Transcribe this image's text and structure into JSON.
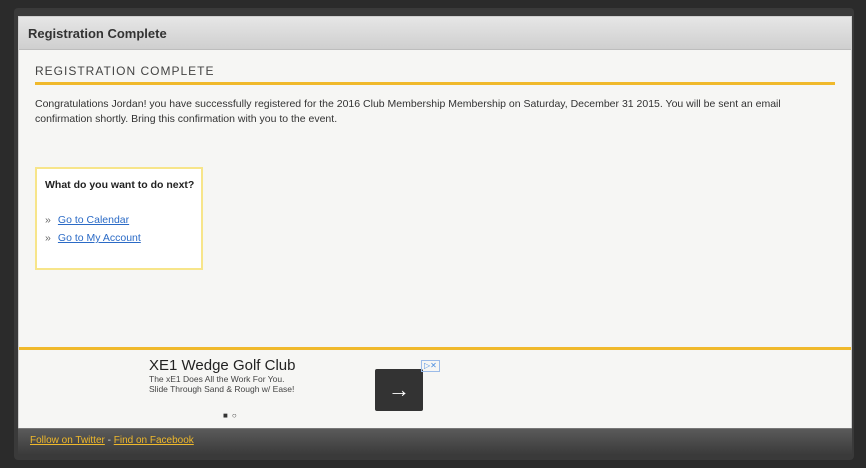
{
  "panel": {
    "header_title": "Registration Complete",
    "section_title": "REGISTRATION COMPLETE",
    "message": "Congratulations Jordan! you have successfully registered for the 2016 Club Membership Membership on Saturday, December 31 2015. You will be sent an email confirmation shortly. Bring this confirmation with you to the event."
  },
  "next": {
    "question": "What do you want to do next?",
    "links": [
      {
        "bullet": "»",
        "label": "Go to Calendar"
      },
      {
        "bullet": "»",
        "label": "Go to My Account"
      }
    ]
  },
  "ad": {
    "title": "XE1 Wedge Golf Club",
    "line1": "The xE1 Does All the Work For You.",
    "line2": "Slide Through Sand & Rough w/ Ease!",
    "arrow_icon": "arrow-right-icon",
    "adchoices_label": "▷✕"
  },
  "footer": {
    "twitter_label": "Follow on Twitter",
    "separator": " - ",
    "facebook_label": "Find on Facebook"
  },
  "colors": {
    "accent": "#f0b92b",
    "link": "#2a6ac6",
    "panel_bg": "#f6f6f4"
  }
}
